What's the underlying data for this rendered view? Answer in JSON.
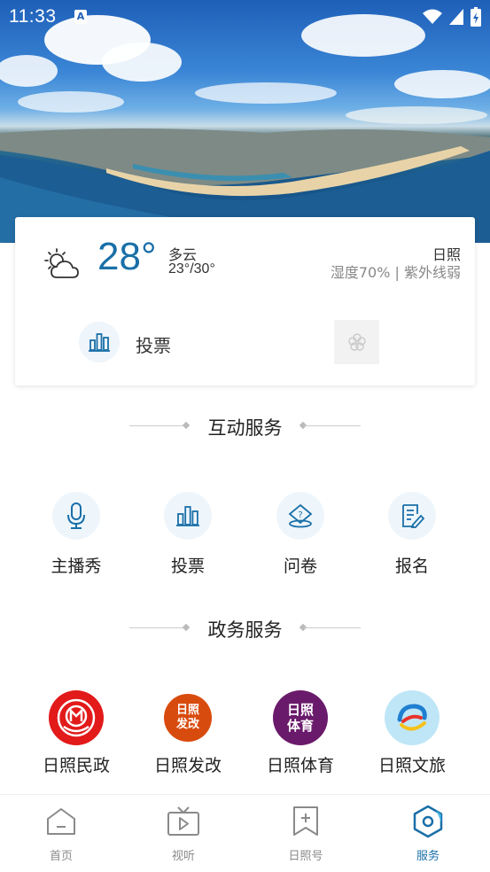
{
  "status_bar": {
    "time": "11:33",
    "a_badge": "A"
  },
  "weather": {
    "temperature": "28°",
    "condition": "多云",
    "range": "23°/30°",
    "city": "日照",
    "detail": "湿度70% | 紫外线弱",
    "vote_label": "投票"
  },
  "sections": {
    "interactive_title": "互动服务",
    "gov_title": "政务服务"
  },
  "interactive_services": [
    {
      "label": "主播秀",
      "icon": "microphone-icon"
    },
    {
      "label": "投票",
      "icon": "bar-chart-icon"
    },
    {
      "label": "问卷",
      "icon": "questionnaire-icon"
    },
    {
      "label": "报名",
      "icon": "signup-form-icon"
    }
  ],
  "gov_services": [
    {
      "label": "日照民政",
      "badge": "",
      "color": "#e21a1a"
    },
    {
      "label": "日照发改",
      "badge": "日照\n发改",
      "color": "#d84b0e"
    },
    {
      "label": "日照体育",
      "badge": "日照\n体育",
      "color": "#6a1a6b"
    },
    {
      "label": "日照文旅",
      "badge": "",
      "color": "#bfe6f7"
    }
  ],
  "bottom_nav": [
    {
      "label": "首页",
      "icon": "home-icon",
      "active": false
    },
    {
      "label": "视听",
      "icon": "tv-icon",
      "active": false
    },
    {
      "label": "日照号",
      "icon": "bookmark-plus-icon",
      "active": false
    },
    {
      "label": "服务",
      "icon": "service-hexagon-icon",
      "active": true
    }
  ],
  "colors": {
    "accent": "#1a6fa8",
    "text": "#222222",
    "muted": "#8a8a8a"
  }
}
